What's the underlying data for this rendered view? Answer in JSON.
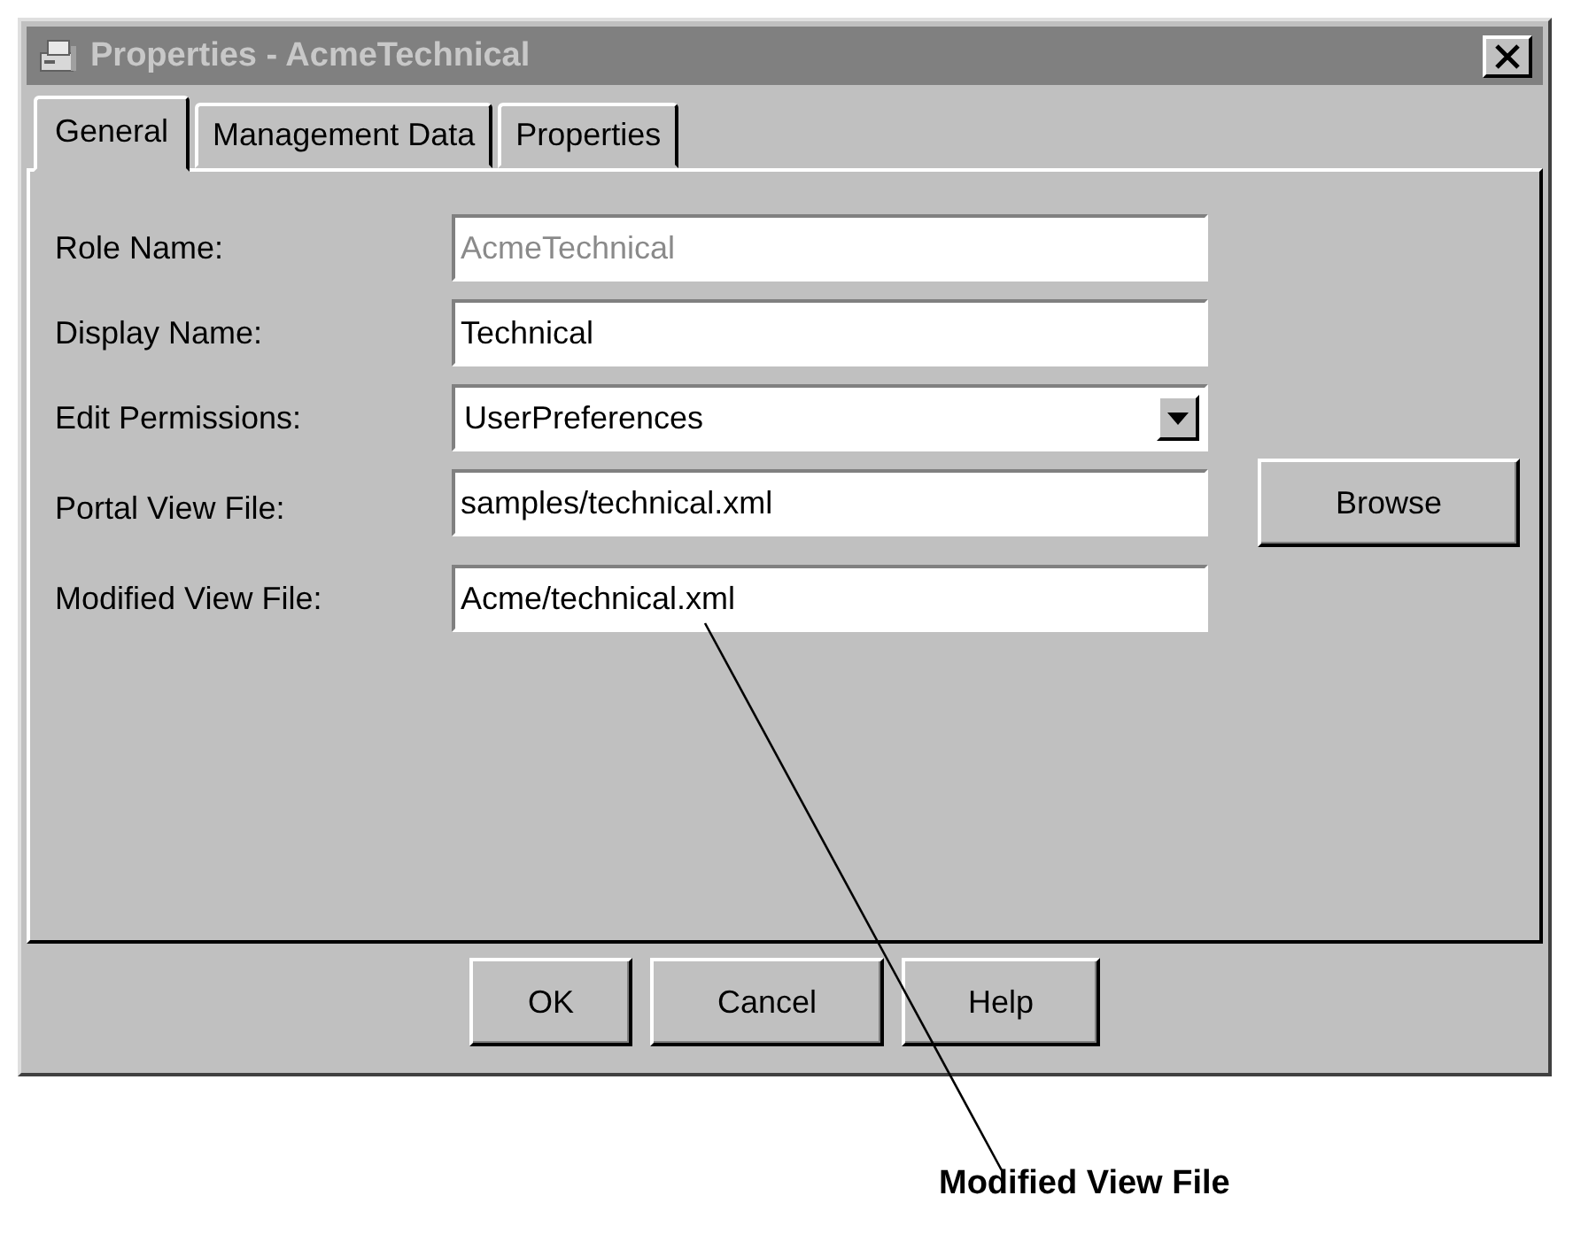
{
  "window": {
    "title": "Properties - AcmeTechnical"
  },
  "tabs": [
    {
      "label": "General",
      "selected": true
    },
    {
      "label": "Management Data",
      "selected": false
    },
    {
      "label": "Properties",
      "selected": false
    }
  ],
  "fields": [
    {
      "label": "Role Name:",
      "value": "AcmeTechnical",
      "kind": "text",
      "disabled": true
    },
    {
      "label": "Display Name:",
      "value": "Technical",
      "kind": "text",
      "disabled": false
    },
    {
      "label": "Edit Permissions:",
      "value": "UserPreferences",
      "kind": "dropdown",
      "disabled": false
    },
    {
      "label": "Portal View File:",
      "value": "samples/technical.xml",
      "kind": "text",
      "disabled": false,
      "action": "Browse"
    },
    {
      "label": "Modified View File:",
      "value": "Acme/technical.xml",
      "kind": "text",
      "disabled": false
    }
  ],
  "buttons": [
    "OK",
    "Cancel",
    "Help"
  ],
  "callout": {
    "label": "Modified View File"
  }
}
